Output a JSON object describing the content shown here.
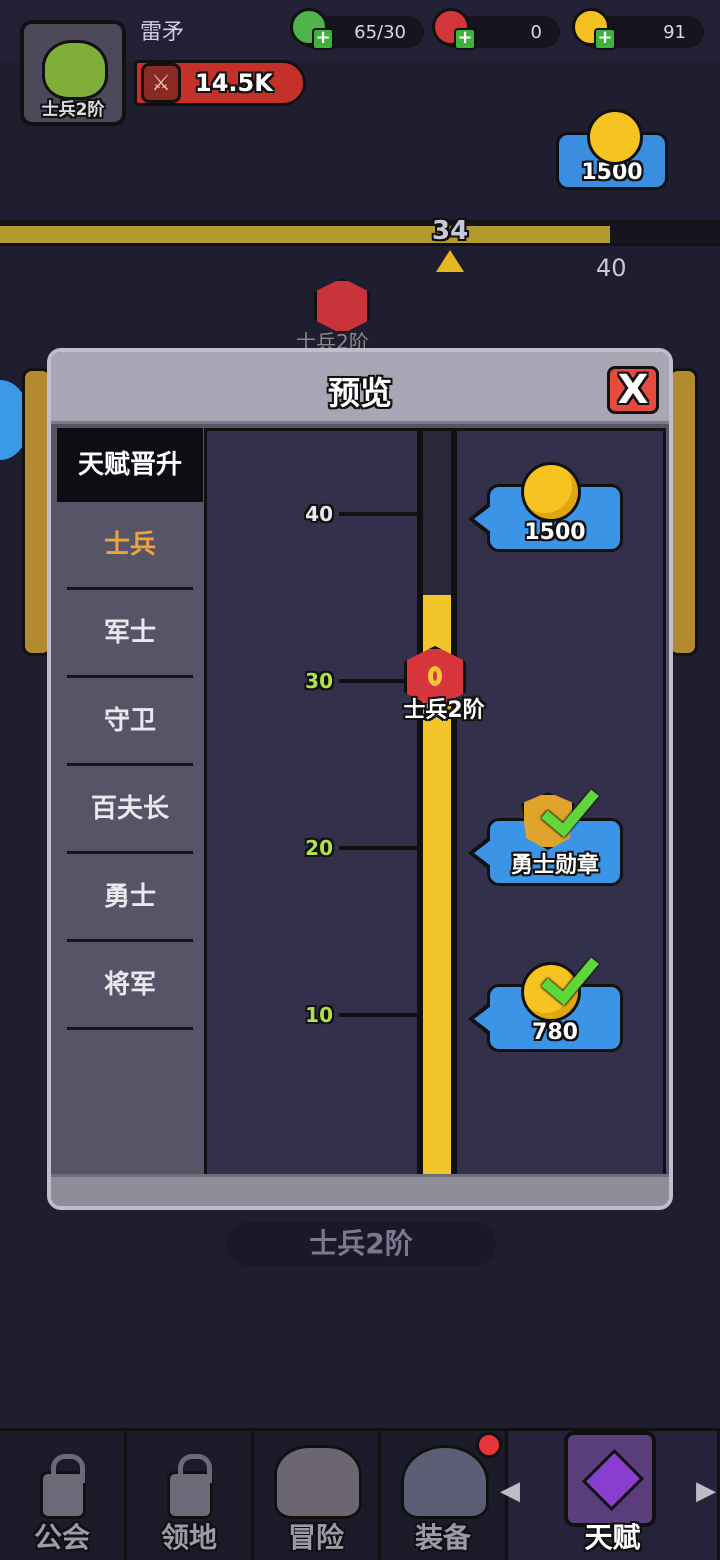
{
  "player": {
    "name": "雷矛",
    "rank": "士兵2阶",
    "power": "14.5K"
  },
  "resources": {
    "energy": "65/30",
    "gems": "0",
    "gold": "91"
  },
  "background": {
    "reward_bubble": "1500",
    "progress_current": "34",
    "progress_next": "40",
    "badge_label": "士兵2阶",
    "bottom_label": "士兵2阶"
  },
  "modal": {
    "title": "预览",
    "close_symbol": "X",
    "menu_header": "天赋晋升",
    "menu_items": [
      "士兵",
      "军士",
      "守卫",
      "百夫长",
      "勇士",
      "将军"
    ],
    "selected_index": 0,
    "scale_ticks": [
      "40",
      "30",
      "20",
      "10"
    ],
    "current_marker_label": "士兵2阶",
    "progress_fraction": 0.78,
    "rewards": [
      {
        "text": "1500",
        "icon": "gold-coin-icon",
        "claimed": false
      },
      {
        "text": "勇士勋章",
        "icon": "warrior-medal-icon",
        "claimed": true
      },
      {
        "text": "780",
        "icon": "gold-coin-icon",
        "claimed": true
      }
    ]
  },
  "nav": {
    "items": [
      "公会",
      "领地",
      "冒险",
      "装备",
      "天赋"
    ]
  },
  "colors": {
    "accent_yellow": "#f2c62a",
    "selected_orange": "#f2a23a",
    "tick_green": "#b2e24a",
    "reward_blue": "#3c94e6",
    "close_red": "#e84a3e"
  }
}
